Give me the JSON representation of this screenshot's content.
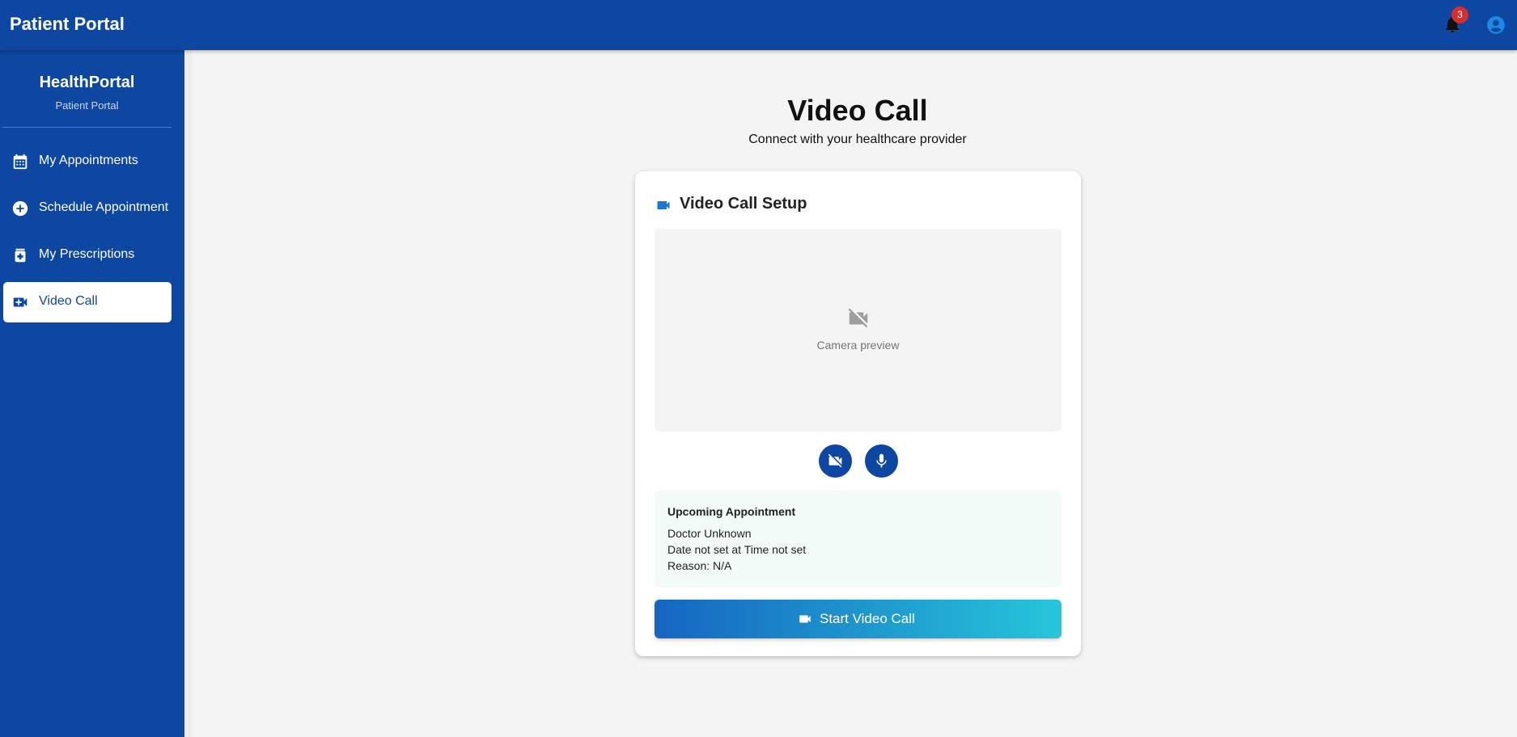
{
  "topbar": {
    "title": "Patient Portal",
    "notification_count": "3"
  },
  "sidebar": {
    "brand": "HealthPortal",
    "brand_subtitle": "Patient Portal",
    "items": [
      {
        "label": "My Appointments",
        "icon": "calendar-icon",
        "active": false
      },
      {
        "label": "Schedule Appointment",
        "icon": "add-circle-icon",
        "active": false
      },
      {
        "label": "My Prescriptions",
        "icon": "medication-icon",
        "active": false
      },
      {
        "label": "Video Call",
        "icon": "video-call-icon",
        "active": true
      }
    ]
  },
  "main": {
    "title": "Video Call",
    "subtitle": "Connect with your healthcare provider"
  },
  "card": {
    "title": "Video Call Setup",
    "preview_label": "Camera preview",
    "controls": [
      {
        "name": "toggle-camera",
        "icon": "videocam-off-icon"
      },
      {
        "name": "toggle-microphone",
        "icon": "microphone-icon"
      }
    ],
    "appointment": {
      "heading": "Upcoming Appointment",
      "doctor": "Doctor Unknown",
      "datetime": "Date not set at Time not set",
      "reason": "Reason: N/A"
    },
    "start_button_label": "Start Video Call"
  },
  "colors": {
    "primary": "#0d47a1",
    "badge": "#d32f2f",
    "page_background": "#f4f4f4",
    "gradient_start": "#1565c0",
    "gradient_end": "#26c6da",
    "appointment_background": "#f3fbf8"
  }
}
